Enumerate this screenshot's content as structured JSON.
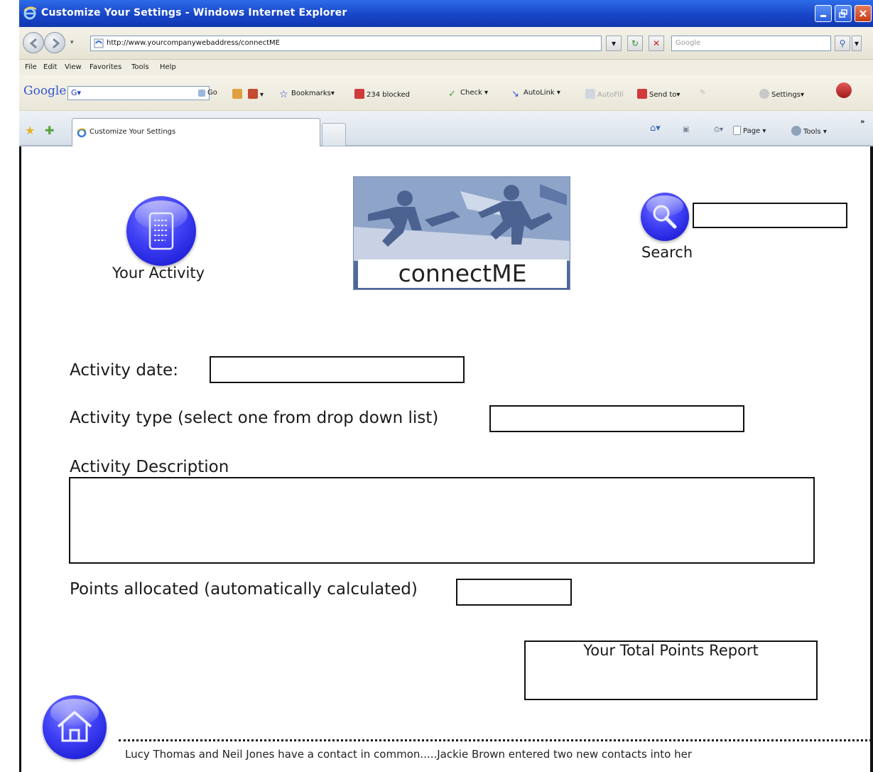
{
  "window": {
    "title": "Customize Your Settings - Windows Internet Explorer"
  },
  "address_bar": {
    "url": "http://www.yourcompanywebaddress/connectME",
    "search_placeholder": "Google"
  },
  "menu": {
    "items": [
      "File",
      "Edit",
      "View",
      "Favorites",
      "Tools",
      "Help"
    ]
  },
  "google_toolbar": {
    "logo": "Google",
    "search_value": "G▾",
    "go_label": "Go",
    "bookmarks_label": "Bookmarks▾",
    "blocked_label": "234 blocked",
    "check_label": "Check ▾",
    "autolink_label": "AutoLink ▾",
    "autofill_label": "AutoFill",
    "sendto_label": "Send to▾",
    "settings_label": "Settings▾"
  },
  "tabs": {
    "active_label": "Customize Your Settings",
    "page_label": "Page ▾",
    "tools_label": "Tools ▾"
  },
  "page": {
    "activity_label": "Your Activity",
    "logo_text": "connectME",
    "search_label": "Search",
    "activity_date_label": "Activity date:",
    "activity_type_label": "Activity type (select one from drop down list)",
    "activity_description_label": "Activity Description",
    "points_label": "Points allocated (automatically calculated)",
    "total_points_label": "Your Total Points Report",
    "ticker_text": "Lucy Thomas and Neil Jones have a contact in common.....Jackie Brown entered two new contacts into her"
  },
  "colors": {
    "orb_blue": "#3f3ff5",
    "titlebar_blue": "#1845c8"
  }
}
